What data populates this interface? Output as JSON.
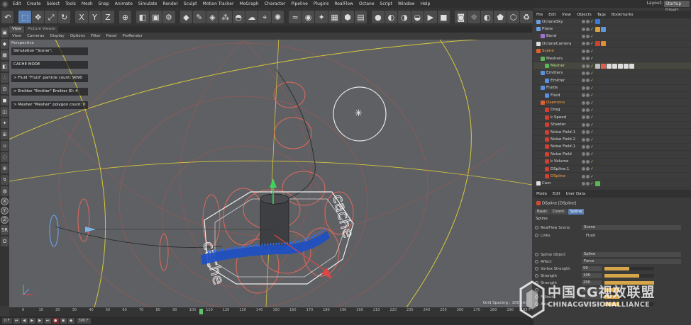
{
  "app": {
    "menu": [
      "Edit",
      "Create",
      "Select",
      "Tools",
      "Mesh",
      "Snap",
      "Animate",
      "Simulate",
      "Render",
      "Sculpt",
      "Motion Tracker",
      "MoGraph",
      "Character",
      "Pipeline",
      "Plugins",
      "RealFlow",
      "Octane",
      "Script",
      "Window",
      "Help"
    ],
    "layout_label": "Layout:",
    "layout_value": "Startup (User)"
  },
  "toolbar": {
    "icons": [
      "undo-icon",
      "live-selection-icon",
      "move-icon",
      "scale-icon",
      "rotate-icon",
      "axis-x-icon",
      "axis-y-icon",
      "axis-z-icon",
      "world-coordinates-icon",
      "render-view-icon",
      "render-picture-viewer-icon",
      "render-settings-icon",
      "cube-icon",
      "pen-icon",
      "subdivision-icon",
      "array-icon",
      "deformer-icon",
      "environment-icon",
      "camera-icon",
      "light-icon",
      "realflow-fluid-icon",
      "realflow-emitter-icon",
      "realflow-daemon-icon",
      "realflow-mesher-icon",
      "realflow-scene-icon",
      "realflow-cache-icon",
      "octane-sphere-icon",
      "octane-material-icon",
      "octane-light-icon",
      "octane-camera-icon",
      "octane-live-viewer-icon",
      "octane-render-icon",
      "octane-settings-icon",
      "octane-sun-icon",
      "octane-half-icon",
      "octane-texture-icon",
      "octane-tag-icon",
      "octane-refresh-icon"
    ]
  },
  "viewport": {
    "tabs": [
      "View",
      "Picture Viewer"
    ],
    "menu": [
      "View",
      "Cameras",
      "Display",
      "Options",
      "Filter",
      "Panel",
      "ProRender"
    ],
    "label": "Perspective",
    "overlay": [
      "Simulation \"Scene\":",
      "CACHE MODE",
      "> Fluid \"Fluid\" particle count: 9090",
      "> Emitter \"Emitter\" Emitter ID: 4",
      "> Mesher \"Mesher\" polygon count: 0"
    ],
    "grid_spacing": "Grid Spacing : 100 cm",
    "cage_text": "cache"
  },
  "timeline": {
    "ticks": [
      "0",
      "10",
      "20",
      "30",
      "40",
      "50",
      "60",
      "70",
      "80",
      "90",
      "100",
      "110",
      "120",
      "130",
      "140",
      "150",
      "160",
      "170",
      "180",
      "190",
      "200",
      "210",
      "220",
      "230",
      "240",
      "250",
      "260",
      "270",
      "280",
      "290"
    ],
    "current_frame": 105,
    "end_label": "105 F",
    "start_field": "0 F",
    "end_field": "300 F"
  },
  "object_manager": {
    "menu": [
      "File",
      "Edit",
      "View",
      "Objects",
      "Tags",
      "Bookmarks"
    ],
    "rows": [
      {
        "name": "OctaneSky",
        "color": "normal",
        "icon": "#6aa0e8",
        "indent": 0,
        "tags": [
          "#3a7bd5"
        ]
      },
      {
        "name": "Plane",
        "color": "normal",
        "icon": "#6aa0e8",
        "indent": 0,
        "tags": [
          "#d9a040",
          "#5a9ae0"
        ]
      },
      {
        "name": "Bend",
        "color": "normal",
        "icon": "#a070d8",
        "indent": 6,
        "tags": []
      },
      {
        "name": "OctaneCamera",
        "color": "normal",
        "icon": "#e0e0e0",
        "indent": 0,
        "tags": [
          "#d04030",
          "#e09030"
        ]
      },
      {
        "name": "Scene",
        "color": "orange",
        "icon": "#e06030",
        "indent": 0,
        "tags": []
      },
      {
        "name": "Meshers",
        "color": "normal",
        "icon": "#58b858",
        "indent": 6,
        "tags": []
      },
      {
        "name": "Mesher",
        "color": "green",
        "icon": "#58b858",
        "indent": 12,
        "tags": [
          "#c0c0c0",
          "#e06050",
          "#ddd",
          "#ddd",
          "#ddd",
          "#ddd",
          "#ddd"
        ]
      },
      {
        "name": "Emitters",
        "color": "normal",
        "icon": "#5a90e0",
        "indent": 6,
        "tags": []
      },
      {
        "name": "Emitter",
        "color": "normal",
        "icon": "#5a90e0",
        "indent": 12,
        "tags": []
      },
      {
        "name": "Fluids",
        "color": "normal",
        "icon": "#5a90e0",
        "indent": 6,
        "tags": []
      },
      {
        "name": "Fluid",
        "color": "normal",
        "icon": "#5a90e0",
        "indent": 12,
        "tags": []
      },
      {
        "name": "Daemons",
        "color": "orange",
        "icon": "#e06030",
        "indent": 6,
        "tags": []
      },
      {
        "name": "Drag",
        "color": "normal",
        "icon": "#d04030",
        "indent": 12,
        "tags": []
      },
      {
        "name": "k Speed",
        "color": "normal",
        "icon": "#d04030",
        "indent": 12,
        "tags": []
      },
      {
        "name": "Sheeter",
        "color": "normal",
        "icon": "#d04030",
        "indent": 12,
        "tags": []
      },
      {
        "name": "Noise Field.1",
        "color": "normal",
        "icon": "#d04030",
        "indent": 12,
        "tags": []
      },
      {
        "name": "Noise Field.2",
        "color": "normal",
        "icon": "#d04030",
        "indent": 12,
        "tags": []
      },
      {
        "name": "Noise Field.1",
        "color": "normal",
        "icon": "#d04030",
        "indent": 12,
        "tags": []
      },
      {
        "name": "Noise Field",
        "color": "normal",
        "icon": "#d04030",
        "indent": 12,
        "tags": []
      },
      {
        "name": "k Volume",
        "color": "normal",
        "icon": "#d04030",
        "indent": 12,
        "tags": []
      },
      {
        "name": "DSpline.1",
        "color": "normal",
        "icon": "#d04030",
        "indent": 12,
        "tags": []
      },
      {
        "name": "DSpline",
        "color": "orange",
        "icon": "#d04030",
        "indent": 12,
        "tags": []
      },
      {
        "name": "Cam",
        "color": "normal",
        "icon": "#e0e0e0",
        "indent": 0,
        "tags": [
          "#58b858"
        ]
      }
    ]
  },
  "attribute_manager": {
    "menu": [
      "Mode",
      "Edit",
      "User Data"
    ],
    "title": "DSpline [DSpline]",
    "tabs": [
      "Basic",
      "Coord.",
      "Spline"
    ],
    "active_tab": "Spline",
    "section": "Spline",
    "realflow_scene_label": "RealFlow Scene",
    "realflow_scene_value": "Scene",
    "links_label": "Links",
    "links_value": "Fluid",
    "spline_object_label": "Spline Object",
    "spline_object_value": "Spline",
    "affect_label": "Affect",
    "affect_value": "Force",
    "params": [
      {
        "label": "Vortex Strength",
        "value": "50",
        "fill": 0.5
      },
      {
        "label": "Strength",
        "value": "100",
        "fill": 0.7
      },
      {
        "label": "Strength",
        "value": "200",
        "fill": 1.0
      },
      {
        "label": "",
        "value": "1",
        "fill": 0.3
      },
      {
        "label": "Fallout",
        "value": "1",
        "fill": 0.3
      },
      {
        "label": "Axial",
        "value": "1",
        "fill": 0.3
      }
    ]
  },
  "watermark": {
    "cn": "中国CG视效联盟",
    "en": "CHINACGVISIONALLIANCE"
  }
}
